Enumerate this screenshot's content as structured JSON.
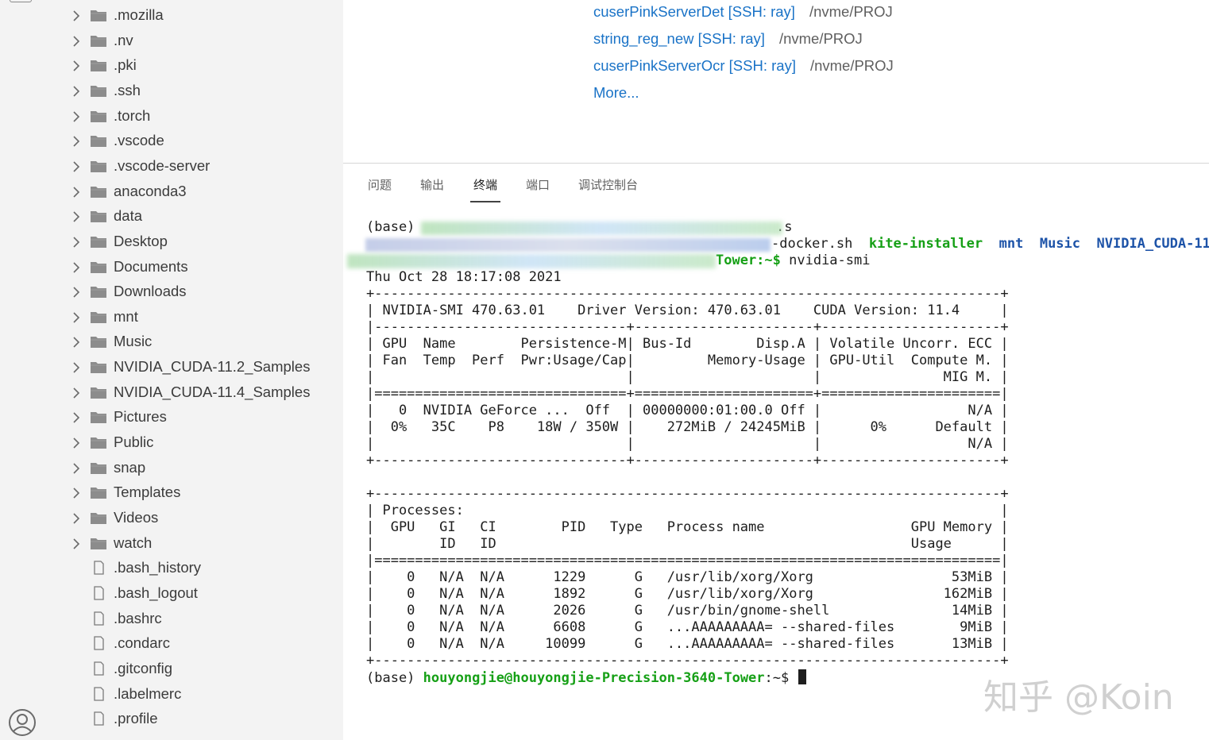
{
  "sidebar": {
    "folders": [
      ".mozilla",
      ".nv",
      ".pki",
      ".ssh",
      ".torch",
      ".vscode",
      ".vscode-server",
      "anaconda3",
      "data",
      "Desktop",
      "Documents",
      "Downloads",
      "mnt",
      "Music",
      "NVIDIA_CUDA-11.2_Samples",
      "NVIDIA_CUDA-11.4_Samples",
      "Pictures",
      "Public",
      "snap",
      "Templates",
      "Videos",
      "watch"
    ],
    "files": [
      ".bash_history",
      ".bash_logout",
      ".bashrc",
      ".condarc",
      ".gitconfig",
      ".labelmerc",
      ".profile"
    ]
  },
  "editor": {
    "recent": [
      {
        "name": "cuserPinkServerDet [SSH: ray]",
        "path": "/nvme/PROJ"
      },
      {
        "name": "string_reg_new [SSH: ray]",
        "path": "/nvme/PROJ"
      },
      {
        "name": "cuserPinkServerOcr [SSH: ray]",
        "path": "/nvme/PROJ"
      }
    ],
    "more_label": "More..."
  },
  "panel": {
    "tabs": [
      "问题",
      "输出",
      "终端",
      "端口",
      "调试控制台"
    ],
    "active_tab": "终端"
  },
  "terminal": {
    "line1_prefix": "(base) ",
    "line1_suffix": ".s",
    "line2_items": [
      "-docker.sh",
      "kite-installer",
      "mnt",
      "Music",
      "NVIDIA_CUDA-11."
    ],
    "line3_prompt_end": "Tower:~$ ",
    "line3_command": "nvidia-smi",
    "lines": [
      "Thu Oct 28 18:17:08 2021",
      "+-----------------------------------------------------------------------------+",
      "| NVIDIA-SMI 470.63.01    Driver Version: 470.63.01    CUDA Version: 11.4     |",
      "|-------------------------------+----------------------+----------------------+",
      "| GPU  Name        Persistence-M| Bus-Id        Disp.A | Volatile Uncorr. ECC |",
      "| Fan  Temp  Perf  Pwr:Usage/Cap|         Memory-Usage | GPU-Util  Compute M. |",
      "|                               |                      |               MIG M. |",
      "|===============================+======================+======================|",
      "|   0  NVIDIA GeForce ...  Off  | 00000000:01:00.0 Off |                  N/A |",
      "|  0%   35C    P8    18W / 350W |    272MiB / 24245MiB |      0%      Default |",
      "|                               |                      |                  N/A |",
      "+-------------------------------+----------------------+----------------------+",
      "",
      "+-----------------------------------------------------------------------------+",
      "| Processes:                                                                  |",
      "|  GPU   GI   CI        PID   Type   Process name                  GPU Memory |",
      "|        ID   ID                                                   Usage      |",
      "|=============================================================================|",
      "|    0   N/A  N/A      1229      G   /usr/lib/xorg/Xorg                 53MiB |",
      "|    0   N/A  N/A      1892      G   /usr/lib/xorg/Xorg                162MiB |",
      "|    0   N/A  N/A      2026      G   /usr/bin/gnome-shell               14MiB |",
      "|    0   N/A  N/A      6608      G   ...AAAAAAAAA= --shared-files        9MiB |",
      "|    0   N/A  N/A     10099      G   ...AAAAAAAAA= --shared-files       13MiB |",
      "+-----------------------------------------------------------------------------+"
    ],
    "final_prefix": "(base) ",
    "final_user": "houyongjie@houyongjie-Precision-3640-Tower",
    "final_prompt": ":~$ "
  },
  "watermark": "知乎 @Koin",
  "icons": {
    "folder": "folder-icon",
    "file": "file-icon",
    "chevron": "chevron-right-icon",
    "account": "account-icon"
  },
  "colors": {
    "link": "#1a73c7",
    "prompt_green": "#16a016",
    "dir_blue": "#1d53a8"
  }
}
